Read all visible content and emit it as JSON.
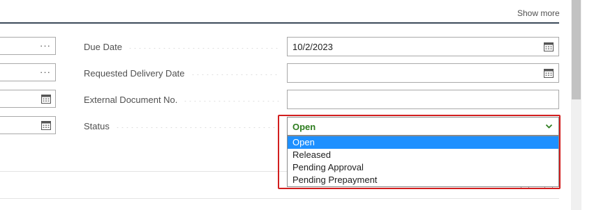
{
  "header": {
    "show_more_label": "Show more"
  },
  "left_column": {
    "fields": [
      {
        "type": "lookup",
        "icon": "ellipsis-icon",
        "glyph": "···"
      },
      {
        "type": "lookup",
        "icon": "ellipsis-icon",
        "glyph": "···"
      },
      {
        "type": "date",
        "icon": "calendar-icon"
      },
      {
        "type": "date",
        "icon": "calendar-icon"
      }
    ]
  },
  "fields": {
    "due_date": {
      "label": "Due Date",
      "value": "10/2/2023"
    },
    "requested_delivery_date": {
      "label": "Requested Delivery Date",
      "value": ""
    },
    "external_document_no": {
      "label": "External Document No.",
      "value": ""
    },
    "status": {
      "label": "Status",
      "value": "Open"
    }
  },
  "status_dropdown": {
    "selected": "Open",
    "options": [
      "Open",
      "Released",
      "Pending Approval",
      "Pending Prepayment"
    ]
  },
  "colors": {
    "status_value": "#2e7d1f",
    "selected_option_bg": "#1e90ff",
    "highlight_border": "#d21e1e",
    "header_rule": "#3c4a5a"
  }
}
